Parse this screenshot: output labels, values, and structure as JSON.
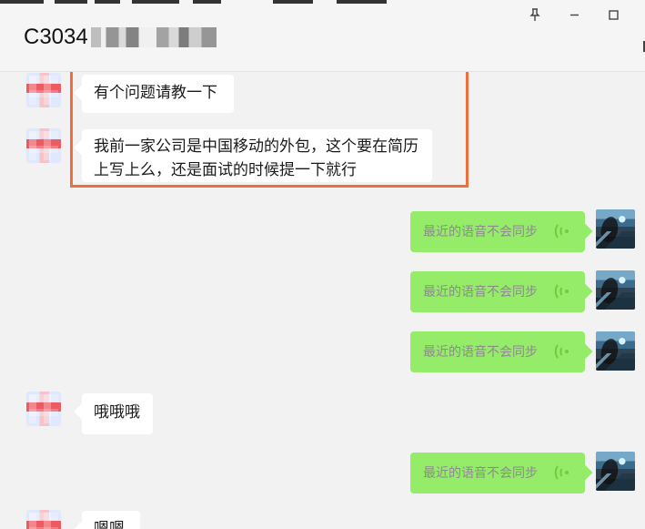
{
  "window": {
    "title_visible": "C3034",
    "title_hidden_segment": "blurred contact name",
    "controls": {
      "pin_icon": "pin-icon",
      "minimize_icon": "minimize-icon",
      "maximize_icon": "maximize-icon"
    }
  },
  "chat": {
    "messages": [
      {
        "side": "left",
        "type": "text",
        "text": "有个问题请教一下"
      },
      {
        "side": "left",
        "type": "text",
        "text": "我前一家公司是中国移动的外包，这个要在简历上写上么，还是面试的时候提一下就行"
      },
      {
        "side": "right",
        "type": "voice",
        "text": "最近的语音不会同步"
      },
      {
        "side": "right",
        "type": "voice",
        "text": "最近的语音不会同步"
      },
      {
        "side": "right",
        "type": "voice",
        "text": "最近的语音不会同步"
      },
      {
        "side": "left",
        "type": "text",
        "text": "哦哦哦"
      },
      {
        "side": "right",
        "type": "voice",
        "text": "最近的语音不会同步"
      },
      {
        "side": "left",
        "type": "text",
        "text": "嗯嗯"
      }
    ]
  },
  "colors": {
    "background": "#f2f2f2",
    "incoming_bubble": "#ffffff",
    "voice_bubble": "#95ec69",
    "highlight": "#f16f3e"
  },
  "icons": {
    "voice_wave": "voice-wave-icon",
    "left_avatar": "blurred-avatar",
    "right_avatar": "lake-photo-avatar"
  }
}
